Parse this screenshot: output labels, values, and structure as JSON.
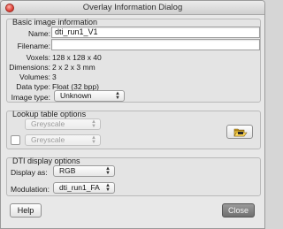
{
  "window": {
    "title": "Overlay Information Dialog"
  },
  "basic": {
    "title": "Basic image information",
    "name_label": "Name:",
    "name_value": "dti_run1_V1",
    "filename_label": "Filename:",
    "filename_value": "",
    "voxels_label": "Voxels:",
    "voxels_value": "128 x 128 x 40",
    "dimensions_label": "Dimensions:",
    "dimensions_value": "2 x 2 x 3 mm",
    "volumes_label": "Volumes:",
    "volumes_value": "3",
    "datatype_label": "Data type:",
    "datatype_value": "Float (32 bpp)",
    "imagetype_label": "Image type:",
    "imagetype_value": "Unknown"
  },
  "lut": {
    "title": "Lookup table options",
    "primary_value": "Greyscale",
    "secondary_value": "Greyscale",
    "secondary_checked": false
  },
  "dti": {
    "title": "DTI display options",
    "display_label": "Display as:",
    "display_value": "RGB",
    "modulation_label": "Modulation:",
    "modulation_value": "dti_run1_FA"
  },
  "buttons": {
    "help": "Help",
    "close": "Close"
  },
  "icons": {
    "close": "close-icon",
    "folder": "folder-open-icon",
    "popup_arrows": "chevron-updown-icon"
  }
}
